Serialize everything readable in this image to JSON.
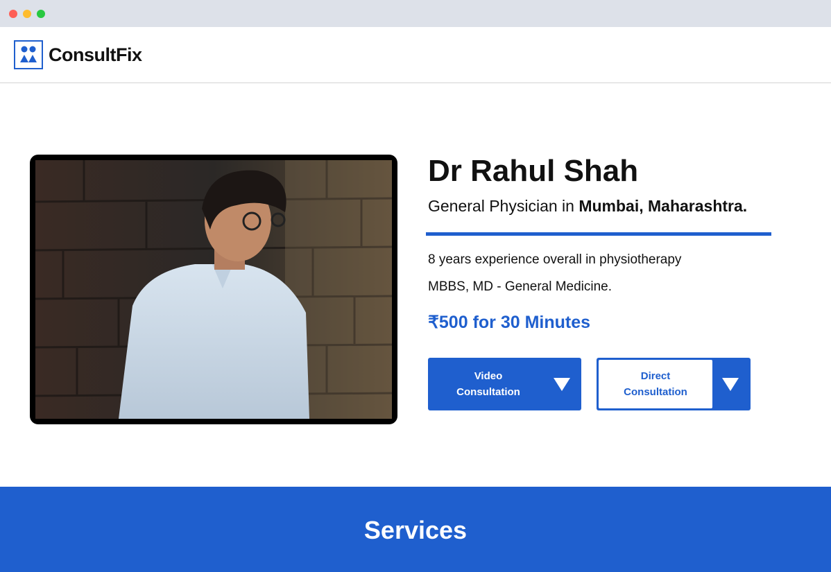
{
  "brand": {
    "name": "ConsultFix",
    "icon": "people-icon",
    "color": "#1f5fce"
  },
  "doctor": {
    "name": "Dr Rahul Shah",
    "specialty_prefix": "General Physician in ",
    "location": "Mumbai, Maharashtra.",
    "experience": "8 years experience overall in physiotherapy",
    "qualifications": "MBBS, MD - General Medicine.",
    "price": "₹500 for 30 Minutes"
  },
  "actions": {
    "video": {
      "line1": "Video",
      "line2": "Consultation"
    },
    "direct": {
      "line1": "Direct",
      "line2": "Consultation"
    }
  },
  "services": {
    "title": "Services"
  },
  "colors": {
    "accent": "#1f5fce",
    "titlebar": "#dde1e9"
  }
}
